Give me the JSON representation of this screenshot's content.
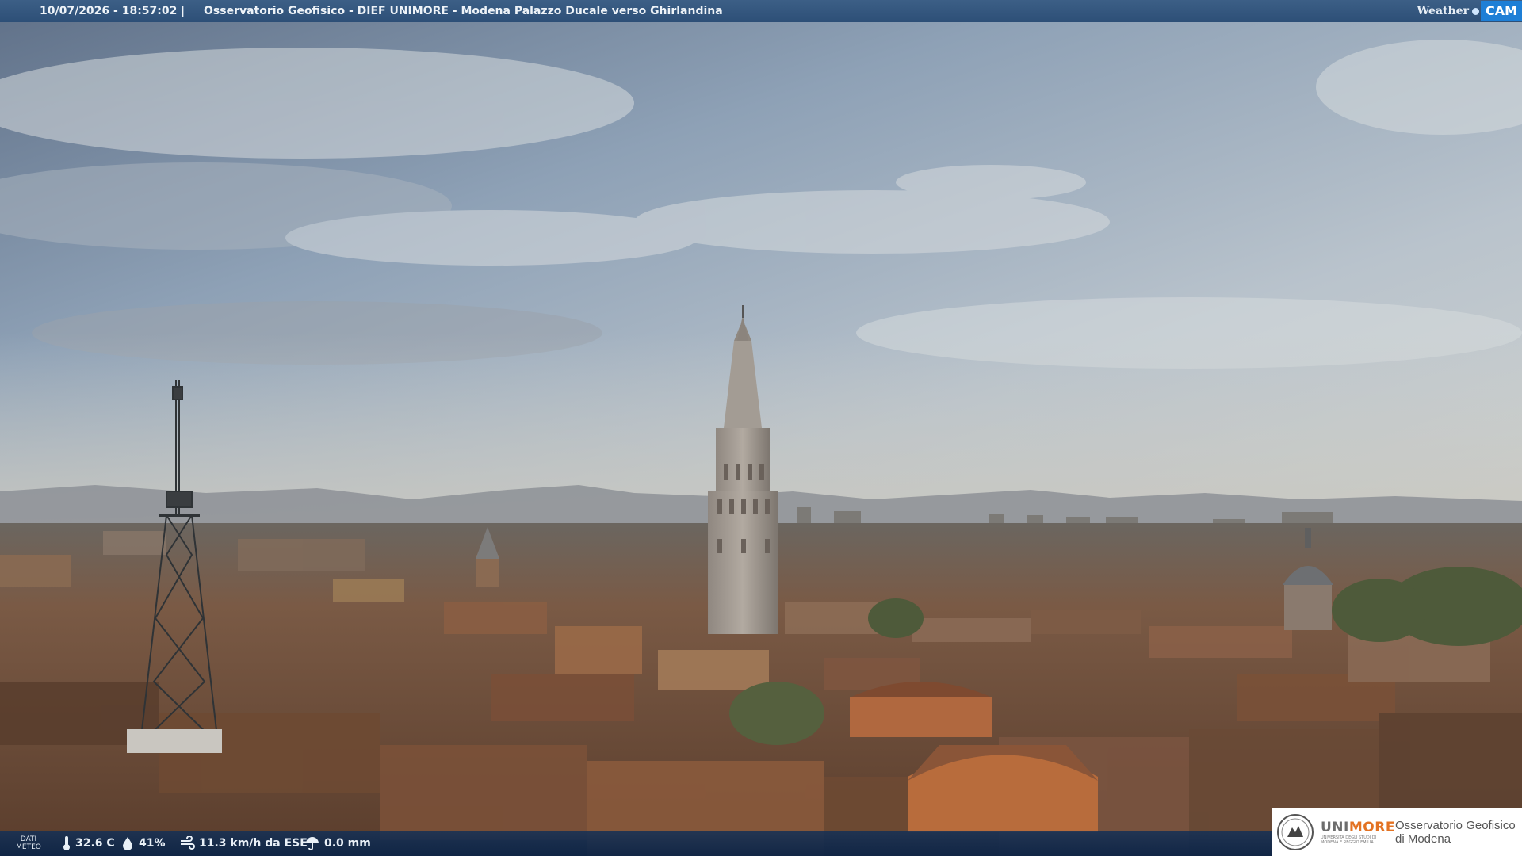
{
  "header": {
    "timestamp": "10/07/2026 - 18:57:02",
    "separator": "|",
    "location": "Osservatorio Geofisico - DIEF UNIMORE - Modena Palazzo Ducale verso Ghirlandina",
    "brand_weather": "Weather",
    "brand_cam": "CAM"
  },
  "weather": {
    "label_line1": "DATI",
    "label_line2": "METEO",
    "temperature": "32.6 C",
    "humidity": "41%",
    "wind": "11.3 km/h da ESE",
    "rain": "0.0 mm"
  },
  "logo": {
    "uni_part1": "UNI",
    "uni_part2": "MORE",
    "uni_subtitle": "UNIVERSITÀ DEGLI STUDI DI MODENA E REGGIO EMILIA",
    "observatory_line1": "Osservatorio Geofisico",
    "observatory_line2": "di Modena"
  },
  "colors": {
    "bar": "#2d4f77",
    "brand_accent": "#1e7fd6",
    "unimore_orange": "#e37222"
  }
}
